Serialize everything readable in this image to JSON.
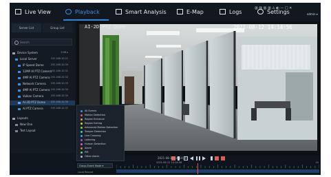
{
  "nav": {
    "items": [
      {
        "label": "Live View",
        "icon": "monitor-icon",
        "active": false
      },
      {
        "label": "Playback",
        "icon": "playback-icon",
        "active": true
      },
      {
        "label": "Smart Analysis",
        "icon": "analytics-icon",
        "active": false
      },
      {
        "label": "E-Map",
        "icon": "map-icon",
        "active": false
      },
      {
        "label": "Logs",
        "icon": "logs-icon",
        "active": false
      },
      {
        "label": "Settings",
        "icon": "gear-icon",
        "active": false
      }
    ],
    "status_icons": "▥ ▥  ▥  ▥  ⚠  ◐  —  □  ✕",
    "user": "admin ▾"
  },
  "sidebar": {
    "tabs": [
      "Server List",
      "Group List"
    ],
    "search_placeholder": "Search",
    "tree": [
      {
        "label": "Device System",
        "meta": "2/48 ▸"
      },
      {
        "label": "Local Server",
        "meta": "192.168.10.21"
      },
      {
        "label": "IP Speed Dome",
        "meta": "192.168.10.30"
      },
      {
        "label": "12MP AI PTZ Camera",
        "meta": "192.168.10.31"
      },
      {
        "label": "4MP AI PTZ Camera",
        "meta": "192.168.10.32"
      },
      {
        "label": "Network Camera",
        "meta": "192.168.10.33"
      },
      {
        "label": "4MP AI PTZ Camera",
        "meta": "192.168.10.34"
      },
      {
        "label": "Vulkan Camera",
        "meta": "192.168.10.35"
      },
      {
        "label": "AI-2D PTZ Dome",
        "meta": "192.168.10.36"
      },
      {
        "label": "AI PTZ Camera",
        "meta": "192.168.10.37"
      },
      {
        "label": "Layouts",
        "meta": ""
      },
      {
        "label": "New One",
        "meta": ""
      },
      {
        "label": "Test Layout",
        "meta": ""
      }
    ]
  },
  "video": {
    "camera_name": "AI-2D PTZ Dome",
    "osd_time": "2021-08-12 14:14:56"
  },
  "controls": {
    "time_text": "2021-08-12 14:14:56"
  },
  "event_filter": {
    "items": [
      {
        "label": "All Events",
        "color": "#3b8fe3"
      },
      {
        "label": "Motion Detection",
        "color": "#e05b5b"
      },
      {
        "label": "Region Entrance",
        "color": "#e0a23b"
      },
      {
        "label": "Region Exiting",
        "color": "#d4d43b"
      },
      {
        "label": "Advanced Motion Detection",
        "color": "#7ad14a"
      },
      {
        "label": "Tamper Detection",
        "color": "#3bd1b8"
      },
      {
        "label": "Line Crossing",
        "color": "#3ba6e0"
      },
      {
        "label": "Loitering",
        "color": "#8a5be0"
      },
      {
        "label": "Human Detection",
        "color": "#e05bc4"
      },
      {
        "label": "Alarm",
        "color": "#e07a3b"
      },
      {
        "label": "PIR",
        "color": "#5be07a"
      },
      {
        "label": "Other Alarm",
        "color": "#b0b8c1"
      }
    ]
  },
  "timeline": {
    "select_label": "Group Event Mode ▾",
    "date_text": "2021-08-12 14:14:56",
    "zoom_text": "1h",
    "status_text": "Local Record"
  }
}
